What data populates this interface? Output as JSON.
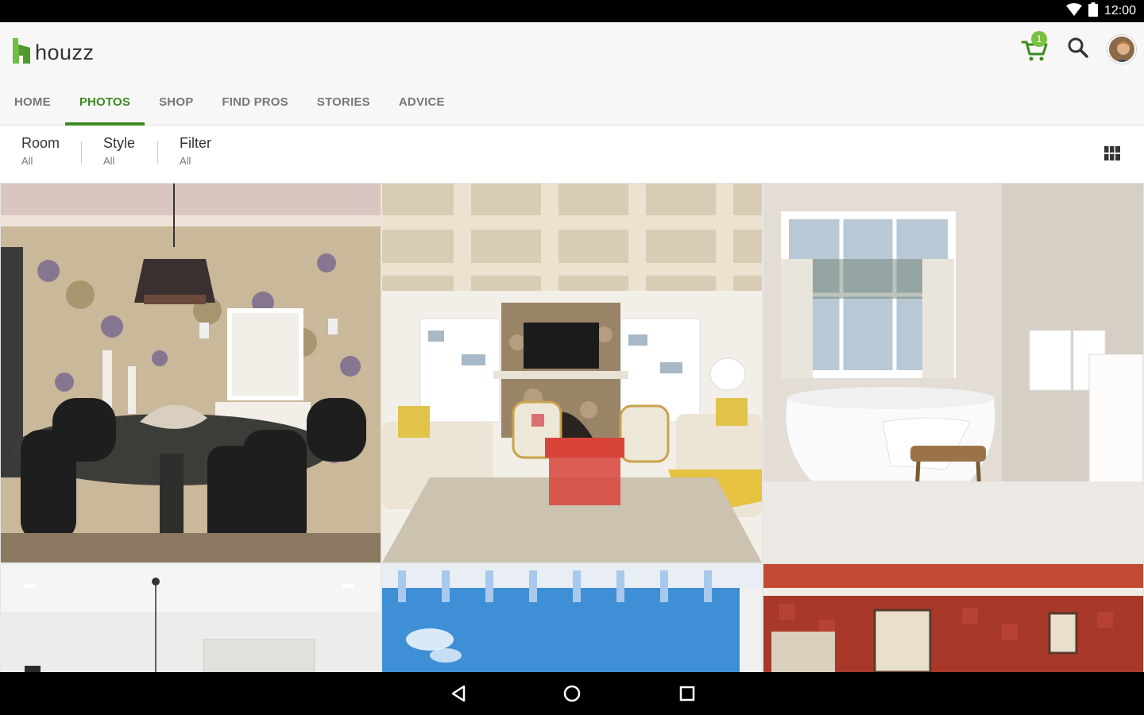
{
  "status_bar": {
    "time": "12:00",
    "icons": [
      "wifi-icon",
      "battery-icon"
    ]
  },
  "app": {
    "name": "houzz",
    "brand_color": "#3c8a1e"
  },
  "header": {
    "cart_count": "1"
  },
  "tabs": [
    {
      "label": "HOME",
      "active": false
    },
    {
      "label": "PHOTOS",
      "active": true
    },
    {
      "label": "SHOP",
      "active": false
    },
    {
      "label": "FIND PROS",
      "active": false
    },
    {
      "label": "STORIES",
      "active": false
    },
    {
      "label": "ADVICE",
      "active": false
    }
  ],
  "filters": [
    {
      "label": "Room",
      "value": "All"
    },
    {
      "label": "Style",
      "value": "All"
    },
    {
      "label": "Filter",
      "value": "All"
    }
  ],
  "photos": [
    {
      "subject": "dining room with patterned wallpaper and chandelier"
    },
    {
      "subject": "living room with stone fireplace and red coffee table"
    },
    {
      "subject": "white bathroom with freestanding tub"
    },
    {
      "subject": "white room with recessed lights"
    },
    {
      "subject": "pergola against blue sky"
    },
    {
      "subject": "red patterned room with framed art"
    }
  ]
}
